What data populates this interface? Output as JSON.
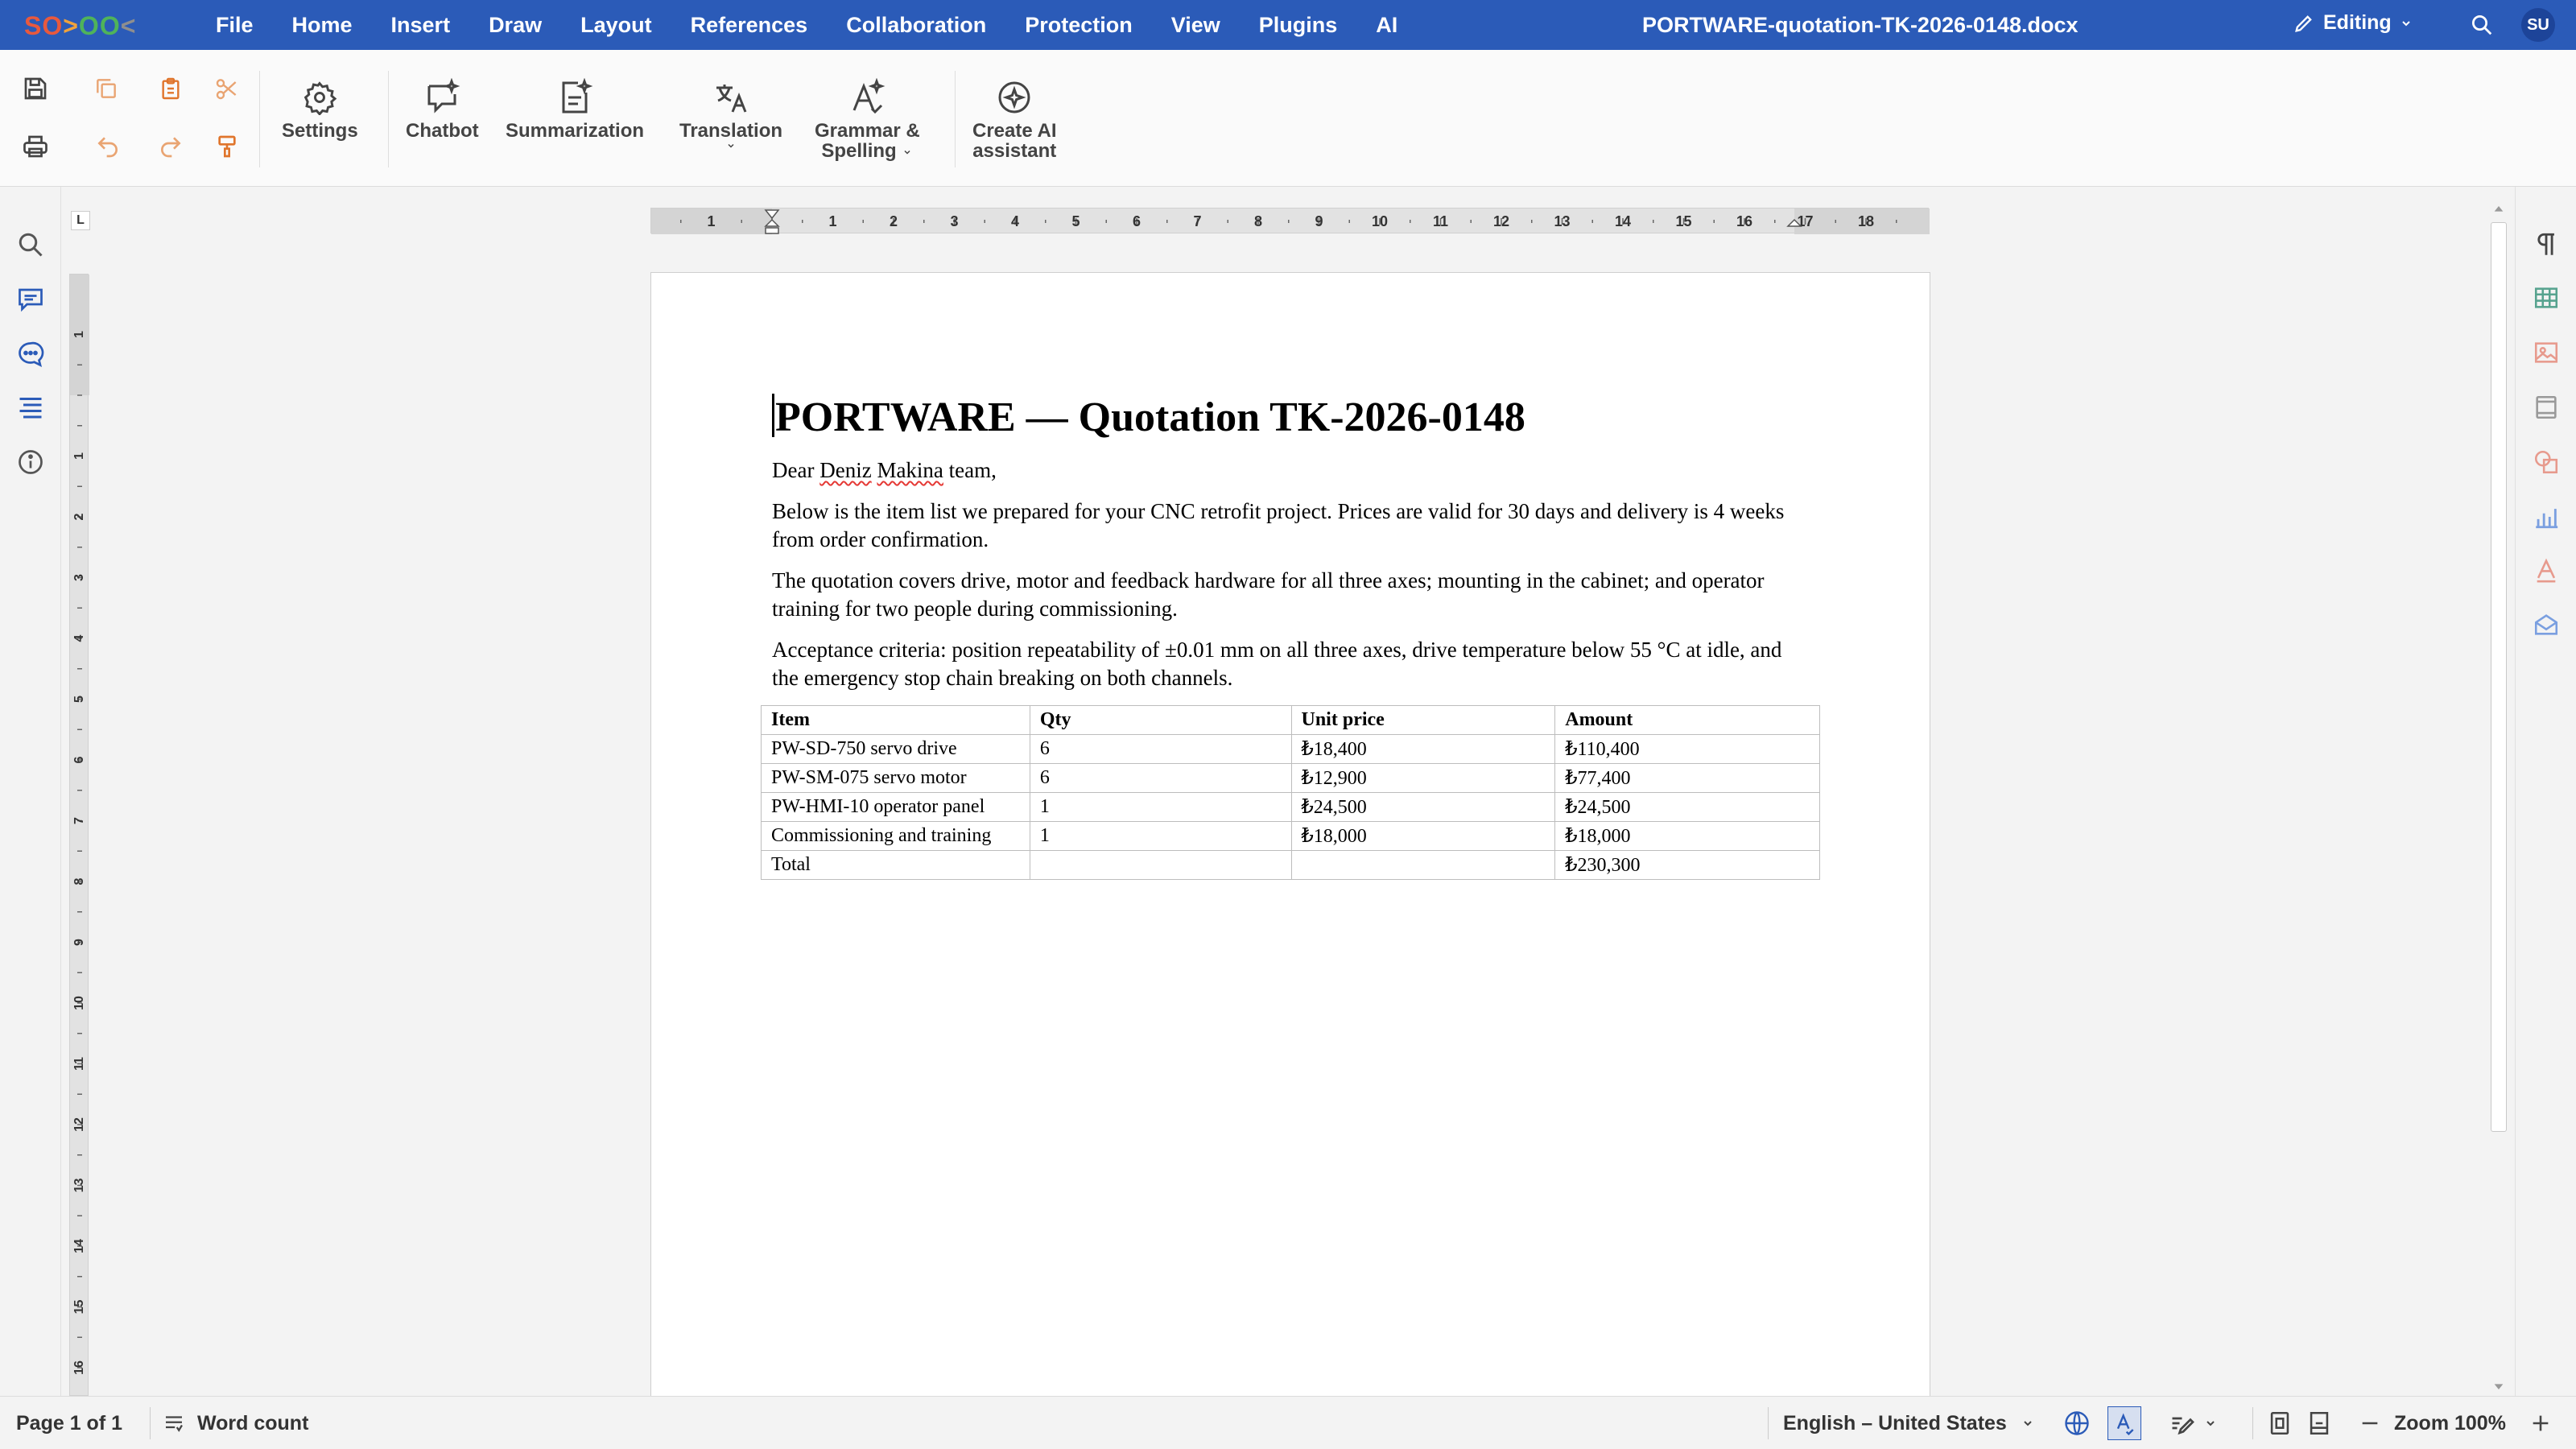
{
  "app": {
    "logo": {
      "p1": "SO",
      "p2": ">",
      "p3": "OO",
      "p4": "<"
    }
  },
  "menu": [
    "File",
    "Home",
    "Insert",
    "Draw",
    "Layout",
    "References",
    "Collaboration",
    "Protection",
    "View",
    "Plugins",
    "AI"
  ],
  "document_title": "PORTWARE-quotation-TK-2026-0148.docx",
  "mode_label": "Editing",
  "user_initials": "SU",
  "toolbar": {
    "settings": "Settings",
    "chatbot": "Chatbot",
    "summarization": "Summarization",
    "translation": "Translation",
    "grammar_line1": "Grammar &",
    "grammar_line2": "Spelling",
    "create_ai_line1": "Create AI",
    "create_ai_line2": "assistant"
  },
  "ruler": {
    "corner": "L",
    "h_labels": [
      "1",
      "1",
      "2",
      "3",
      "4",
      "5",
      "6",
      "7",
      "8",
      "9",
      "10",
      "11",
      "12",
      "13",
      "14",
      "15",
      "16",
      "17",
      "18"
    ],
    "v_labels": [
      "1",
      "1",
      "2",
      "3",
      "4",
      "5",
      "6",
      "7",
      "8",
      "9",
      "10",
      "11",
      "12",
      "13",
      "14",
      "15",
      "16"
    ]
  },
  "doc": {
    "heading": "PORTWARE — Quotation TK-2026-0148",
    "greet_pre": "Dear ",
    "greet_w1": "Deniz",
    "greet_w2": "Makina",
    "greet_post": " team,",
    "para1": "Below is the item list we prepared for your CNC retrofit project. Prices are valid for 30 days and delivery is 4 weeks from order confirmation.",
    "para2": "The quotation covers drive, motor and feedback hardware for all three axes; mounting in the cabinet; and operator training for two people during commissioning.",
    "para3": "Acceptance criteria: position repeatability of ±0.01 mm on all three axes, drive temperature below 55 °C at idle, and the emergency stop chain breaking on both channels.",
    "table": {
      "headers": [
        "Item",
        "Qty",
        "Unit price",
        "Amount"
      ],
      "rows": [
        [
          "PW-SD-750 servo drive",
          "6",
          "₺18,400",
          "₺110,400"
        ],
        [
          "PW-SM-075 servo motor",
          "6",
          "₺12,900",
          "₺77,400"
        ],
        [
          "PW-HMI-10 operator panel",
          "1",
          "₺24,500",
          "₺24,500"
        ],
        [
          "Commissioning and training",
          "1",
          "₺18,000",
          "₺18,000"
        ],
        [
          "Total",
          "",
          "",
          "₺230,300"
        ]
      ]
    }
  },
  "status": {
    "page": "Page 1 of 1",
    "word_count": "Word count",
    "language": "English – United States",
    "zoom": "Zoom 100%"
  }
}
